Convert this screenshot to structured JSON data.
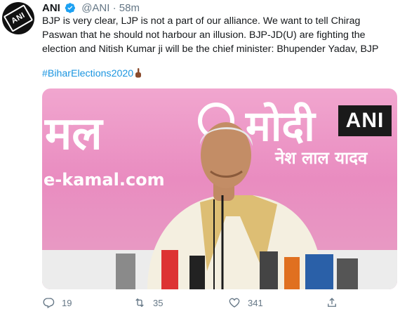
{
  "tweet": {
    "author_name": "ANI",
    "handle": "@ANI",
    "separator": "·",
    "time": "58m",
    "avatar_logo_text": "ANI",
    "text": "BJP is very clear, LJP is not a part of our alliance. We want to tell Chirag Paswan that he should not harbour an illusion. BJP-JD(U) are fighting the election and Nitish Kumar ji will be the chief minister: Bhupender Yadav, BJP",
    "hashtag": "#BiharElections2020",
    "hashtag_emoji": "pointing-finger-emoji"
  },
  "media": {
    "badge_text": "ANI",
    "backdrop": {
      "word1": "मल",
      "word2": "मोदी",
      "subline": "नेश लाल यादव",
      "url": "e-kamal.com"
    }
  },
  "actions": {
    "replies": "19",
    "retweets": "35",
    "likes": "341"
  },
  "colors": {
    "link": "#1b95e0",
    "muted": "#657786",
    "verified": "#1da1f2"
  },
  "icons": [
    "verified-badge-icon",
    "reply-icon",
    "retweet-icon",
    "like-icon",
    "share-icon"
  ]
}
